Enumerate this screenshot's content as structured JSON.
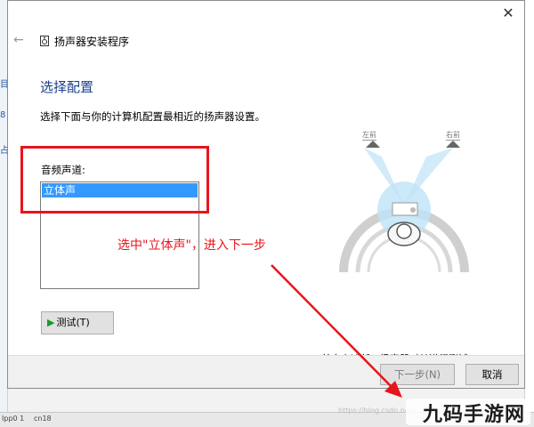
{
  "dialog": {
    "title": "扬声器安装程序",
    "heading": "选择配置",
    "description": "选择下面与你的计算机配置最相近的扬声器设置。",
    "channel_label": "音频声道:",
    "channels": [
      "立体声"
    ],
    "selected_channel": "立体声",
    "test_button": "测试(T)",
    "instruction": "单击上述任一扬声器对其进行测试。",
    "next_button": "下一步(N)",
    "cancel_button": "取消",
    "speaker_left": "左前",
    "speaker_right": "右前"
  },
  "annotation": {
    "text": "选中\"立体声\"，进入下一步",
    "color": "#e8141b"
  },
  "watermark": {
    "text": "九码手游网",
    "faint_url": "https://blog.csdn.net/..."
  },
  "taskbar": {
    "labels": [
      "Ipp0 1",
      "cn18"
    ]
  },
  "background_left": [
    "目",
    "8",
    "占"
  ],
  "colors": {
    "heading": "#1a3f8c",
    "selection": "#3399ff",
    "annotation": "#e8141b"
  },
  "icons": [
    "close-icon",
    "back-arrow-icon",
    "speaker-icon",
    "play-icon"
  ]
}
